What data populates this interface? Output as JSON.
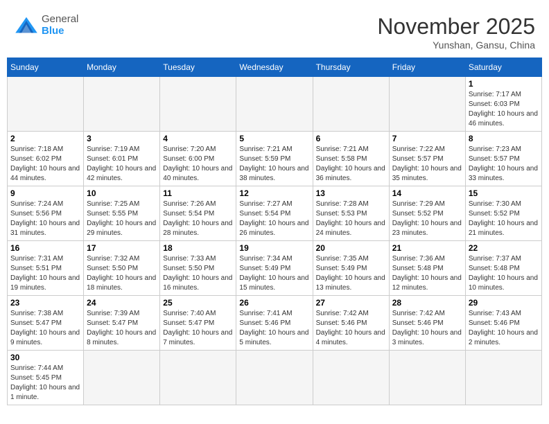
{
  "header": {
    "logo_general": "General",
    "logo_blue": "Blue",
    "month_title": "November 2025",
    "location": "Yunshan, Gansu, China"
  },
  "weekdays": [
    "Sunday",
    "Monday",
    "Tuesday",
    "Wednesday",
    "Thursday",
    "Friday",
    "Saturday"
  ],
  "weeks": [
    [
      {
        "day": "",
        "info": "",
        "empty": true
      },
      {
        "day": "",
        "info": "",
        "empty": true
      },
      {
        "day": "",
        "info": "",
        "empty": true
      },
      {
        "day": "",
        "info": "",
        "empty": true
      },
      {
        "day": "",
        "info": "",
        "empty": true
      },
      {
        "day": "",
        "info": "",
        "empty": true
      },
      {
        "day": "1",
        "info": "Sunrise: 7:17 AM\nSunset: 6:03 PM\nDaylight: 10 hours and 46 minutes."
      }
    ],
    [
      {
        "day": "2",
        "info": "Sunrise: 7:18 AM\nSunset: 6:02 PM\nDaylight: 10 hours and 44 minutes."
      },
      {
        "day": "3",
        "info": "Sunrise: 7:19 AM\nSunset: 6:01 PM\nDaylight: 10 hours and 42 minutes."
      },
      {
        "day": "4",
        "info": "Sunrise: 7:20 AM\nSunset: 6:00 PM\nDaylight: 10 hours and 40 minutes."
      },
      {
        "day": "5",
        "info": "Sunrise: 7:21 AM\nSunset: 5:59 PM\nDaylight: 10 hours and 38 minutes."
      },
      {
        "day": "6",
        "info": "Sunrise: 7:21 AM\nSunset: 5:58 PM\nDaylight: 10 hours and 36 minutes."
      },
      {
        "day": "7",
        "info": "Sunrise: 7:22 AM\nSunset: 5:57 PM\nDaylight: 10 hours and 35 minutes."
      },
      {
        "day": "8",
        "info": "Sunrise: 7:23 AM\nSunset: 5:57 PM\nDaylight: 10 hours and 33 minutes."
      }
    ],
    [
      {
        "day": "9",
        "info": "Sunrise: 7:24 AM\nSunset: 5:56 PM\nDaylight: 10 hours and 31 minutes."
      },
      {
        "day": "10",
        "info": "Sunrise: 7:25 AM\nSunset: 5:55 PM\nDaylight: 10 hours and 29 minutes."
      },
      {
        "day": "11",
        "info": "Sunrise: 7:26 AM\nSunset: 5:54 PM\nDaylight: 10 hours and 28 minutes."
      },
      {
        "day": "12",
        "info": "Sunrise: 7:27 AM\nSunset: 5:54 PM\nDaylight: 10 hours and 26 minutes."
      },
      {
        "day": "13",
        "info": "Sunrise: 7:28 AM\nSunset: 5:53 PM\nDaylight: 10 hours and 24 minutes."
      },
      {
        "day": "14",
        "info": "Sunrise: 7:29 AM\nSunset: 5:52 PM\nDaylight: 10 hours and 23 minutes."
      },
      {
        "day": "15",
        "info": "Sunrise: 7:30 AM\nSunset: 5:52 PM\nDaylight: 10 hours and 21 minutes."
      }
    ],
    [
      {
        "day": "16",
        "info": "Sunrise: 7:31 AM\nSunset: 5:51 PM\nDaylight: 10 hours and 19 minutes."
      },
      {
        "day": "17",
        "info": "Sunrise: 7:32 AM\nSunset: 5:50 PM\nDaylight: 10 hours and 18 minutes."
      },
      {
        "day": "18",
        "info": "Sunrise: 7:33 AM\nSunset: 5:50 PM\nDaylight: 10 hours and 16 minutes."
      },
      {
        "day": "19",
        "info": "Sunrise: 7:34 AM\nSunset: 5:49 PM\nDaylight: 10 hours and 15 minutes."
      },
      {
        "day": "20",
        "info": "Sunrise: 7:35 AM\nSunset: 5:49 PM\nDaylight: 10 hours and 13 minutes."
      },
      {
        "day": "21",
        "info": "Sunrise: 7:36 AM\nSunset: 5:48 PM\nDaylight: 10 hours and 12 minutes."
      },
      {
        "day": "22",
        "info": "Sunrise: 7:37 AM\nSunset: 5:48 PM\nDaylight: 10 hours and 10 minutes."
      }
    ],
    [
      {
        "day": "23",
        "info": "Sunrise: 7:38 AM\nSunset: 5:47 PM\nDaylight: 10 hours and 9 minutes."
      },
      {
        "day": "24",
        "info": "Sunrise: 7:39 AM\nSunset: 5:47 PM\nDaylight: 10 hours and 8 minutes."
      },
      {
        "day": "25",
        "info": "Sunrise: 7:40 AM\nSunset: 5:47 PM\nDaylight: 10 hours and 7 minutes."
      },
      {
        "day": "26",
        "info": "Sunrise: 7:41 AM\nSunset: 5:46 PM\nDaylight: 10 hours and 5 minutes."
      },
      {
        "day": "27",
        "info": "Sunrise: 7:42 AM\nSunset: 5:46 PM\nDaylight: 10 hours and 4 minutes."
      },
      {
        "day": "28",
        "info": "Sunrise: 7:42 AM\nSunset: 5:46 PM\nDaylight: 10 hours and 3 minutes."
      },
      {
        "day": "29",
        "info": "Sunrise: 7:43 AM\nSunset: 5:46 PM\nDaylight: 10 hours and 2 minutes."
      }
    ],
    [
      {
        "day": "30",
        "info": "Sunrise: 7:44 AM\nSunset: 5:45 PM\nDaylight: 10 hours and 1 minute."
      },
      {
        "day": "",
        "info": "",
        "empty": true
      },
      {
        "day": "",
        "info": "",
        "empty": true
      },
      {
        "day": "",
        "info": "",
        "empty": true
      },
      {
        "day": "",
        "info": "",
        "empty": true
      },
      {
        "day": "",
        "info": "",
        "empty": true
      },
      {
        "day": "",
        "info": "",
        "empty": true
      }
    ]
  ]
}
